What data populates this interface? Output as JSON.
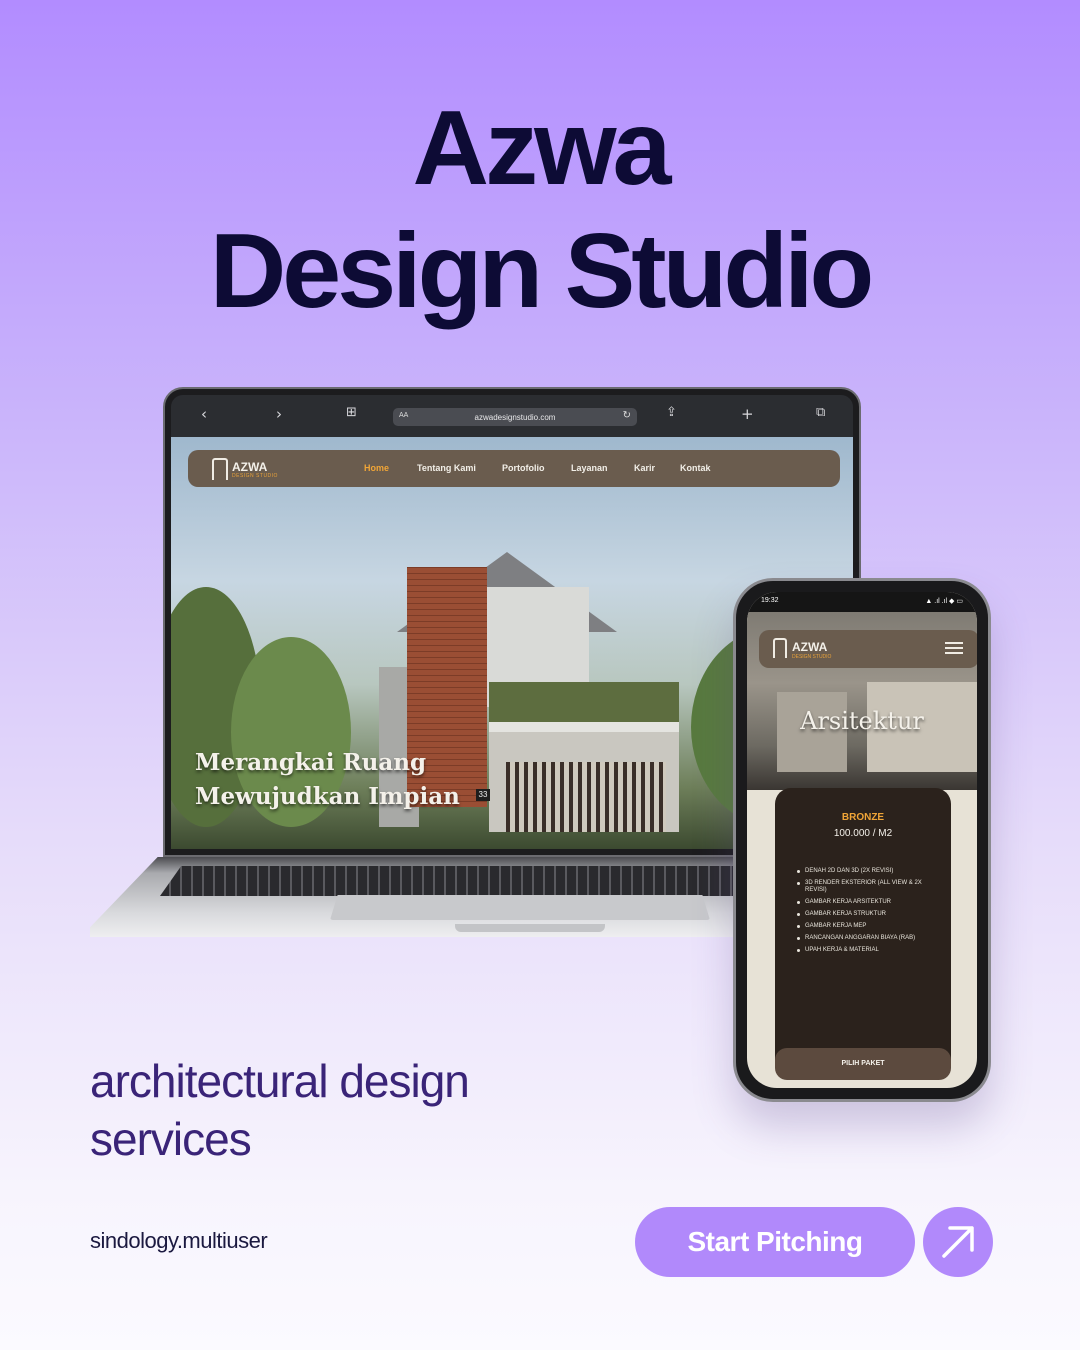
{
  "headline": {
    "line1": "Azwa",
    "line2": "Design Studio"
  },
  "laptop": {
    "browser": {
      "url": "azwadesignstudio.com",
      "aa": "AA",
      "icons": {
        "back": "chevron-left-icon",
        "forward": "chevron-right-icon",
        "book": "book-icon",
        "reload": "reload-icon",
        "share": "share-icon",
        "new_tab": "plus-icon",
        "tabs": "tabs-icon"
      }
    },
    "site": {
      "logo": "AZWA",
      "logo_sub": "DESIGN STUDIO",
      "nav": [
        "Home",
        "Tentang Kami",
        "Portofolio",
        "Layanan",
        "Karir",
        "Kontak"
      ],
      "active_nav": "Home",
      "hero_line1": "Merangkai Ruang",
      "hero_line2": "Mewujudkan Impian",
      "house_number": "33"
    }
  },
  "phone": {
    "status_time": "19:32",
    "status_icons": "▲ .ıl .ıl ◆ ▭",
    "logo": "AZWA",
    "logo_sub": "DESIGN STUDIO",
    "heading": "Arsitektur",
    "card": {
      "title": "BRONZE",
      "price": "100.000 / M2",
      "features": [
        "DENAH 2D DAN 3D (2X REVISI)",
        "3D RENDER EKSTERIOR (ALL VIEW & 2X REVISI)",
        "GAMBAR KERJA ARSITEKTUR",
        "GAMBAR KERJA STRUKTUR",
        "GAMBAR KERJA MEP",
        "RANCANGAN ANGGARAN BIAYA (RAB)",
        "UPAH KERJA & MATERIAL"
      ],
      "button": "PILIH PAKET"
    }
  },
  "subtitle": {
    "line1": "architectural design",
    "line2": "services"
  },
  "handle": "sindology.multiuser",
  "cta": {
    "label": "Start Pitching",
    "icon": "arrow-up-right-icon"
  },
  "colors": {
    "headline": "#0d0b35",
    "accent": "#b189fb",
    "subtitle": "#3a2478",
    "site_brown": "#6a5c4e",
    "site_orange": "#f0a537"
  }
}
